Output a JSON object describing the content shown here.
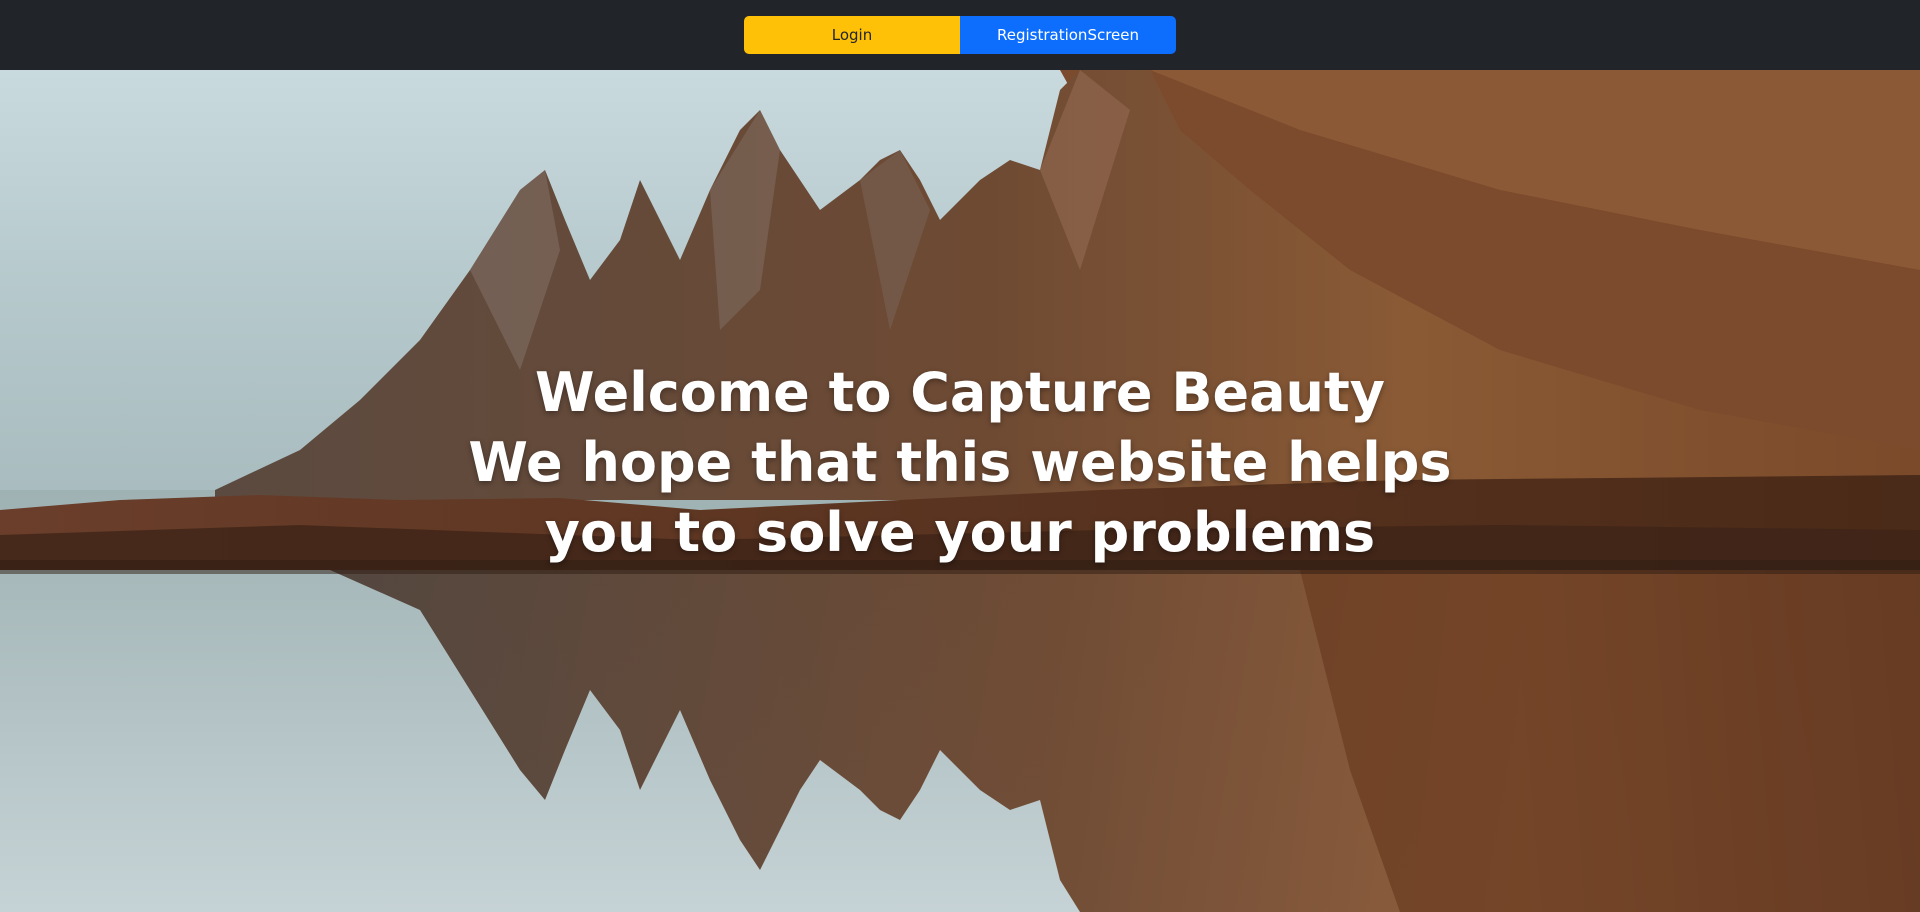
{
  "header": {
    "login_label": "Login",
    "register_label": "RegistrationScreen",
    "background_color": "#212529",
    "login_color": "#ffc107",
    "register_color": "#0d6efd"
  },
  "hero": {
    "lines": [
      "Welcome to Capture Beauty",
      "We hope that this website helps",
      "you to solve your problems"
    ],
    "background_description": "mountain-lake-reflection"
  }
}
